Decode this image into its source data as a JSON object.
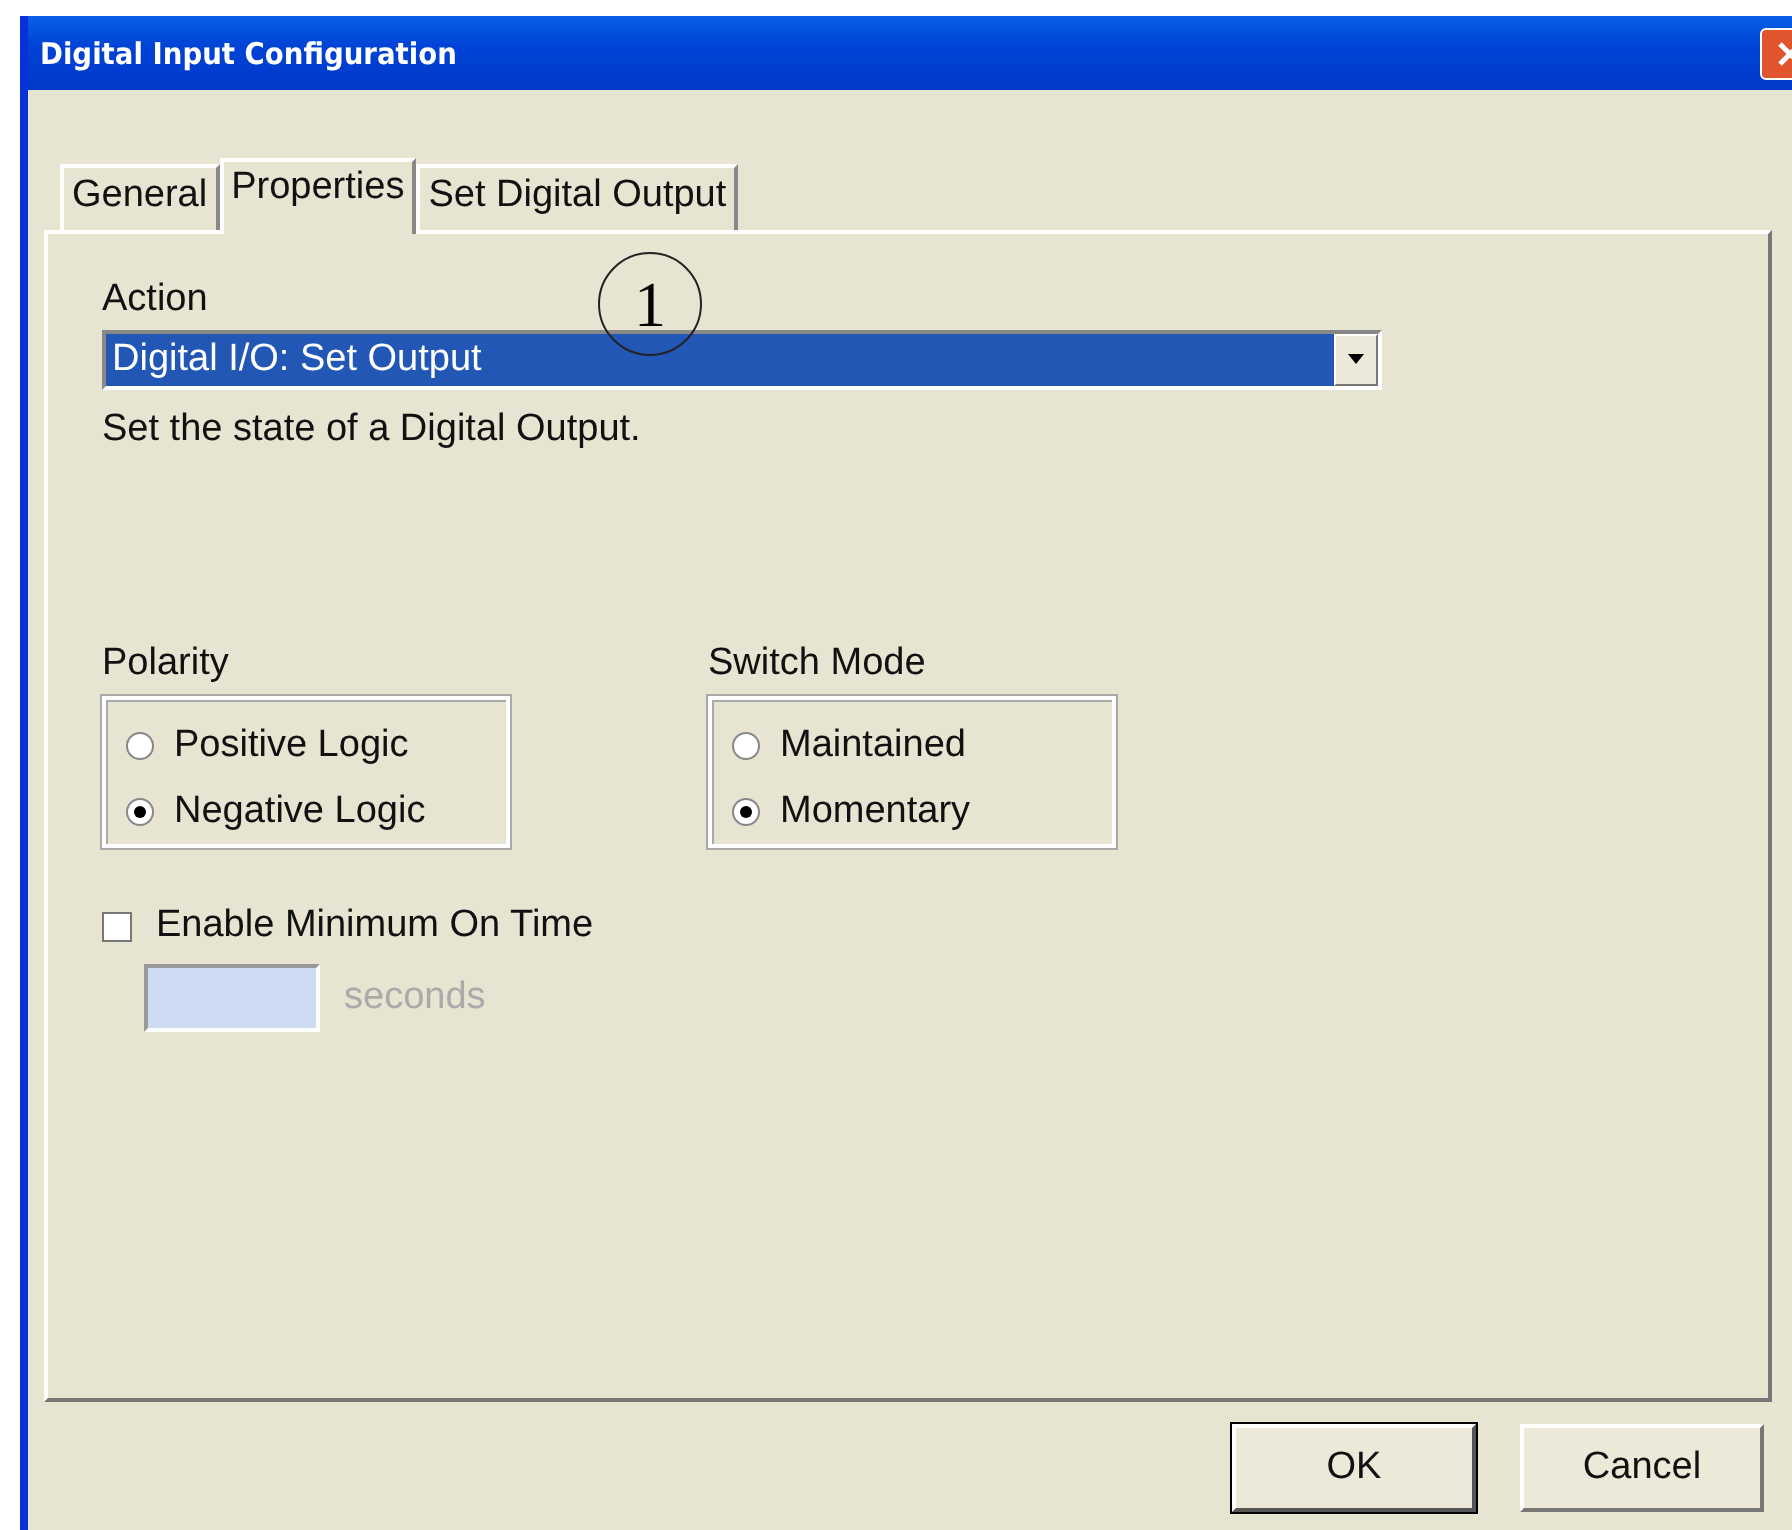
{
  "window": {
    "title": "Digital Input Configuration"
  },
  "tabs": [
    {
      "label": "General",
      "selected": false
    },
    {
      "label": "Properties",
      "selected": true
    },
    {
      "label": "Set Digital Output",
      "selected": false
    }
  ],
  "callout": "1",
  "action": {
    "label": "Action",
    "value": "Digital I/O: Set Output",
    "description": "Set the state of a Digital Output."
  },
  "groups": [
    {
      "label": "Polarity",
      "options": [
        {
          "label": "Positive Logic",
          "selected": false
        },
        {
          "label": "Negative Logic",
          "selected": true
        }
      ]
    },
    {
      "label": "Switch Mode",
      "options": [
        {
          "label": "Maintained",
          "selected": false
        },
        {
          "label": "Momentary",
          "selected": true
        }
      ]
    }
  ],
  "minimum_on_time": {
    "label": "Enable Minimum On Time",
    "checked": false,
    "unit": "seconds"
  },
  "buttons": [
    {
      "label": "OK",
      "default": true
    },
    {
      "label": "Cancel",
      "default": false
    }
  ]
}
